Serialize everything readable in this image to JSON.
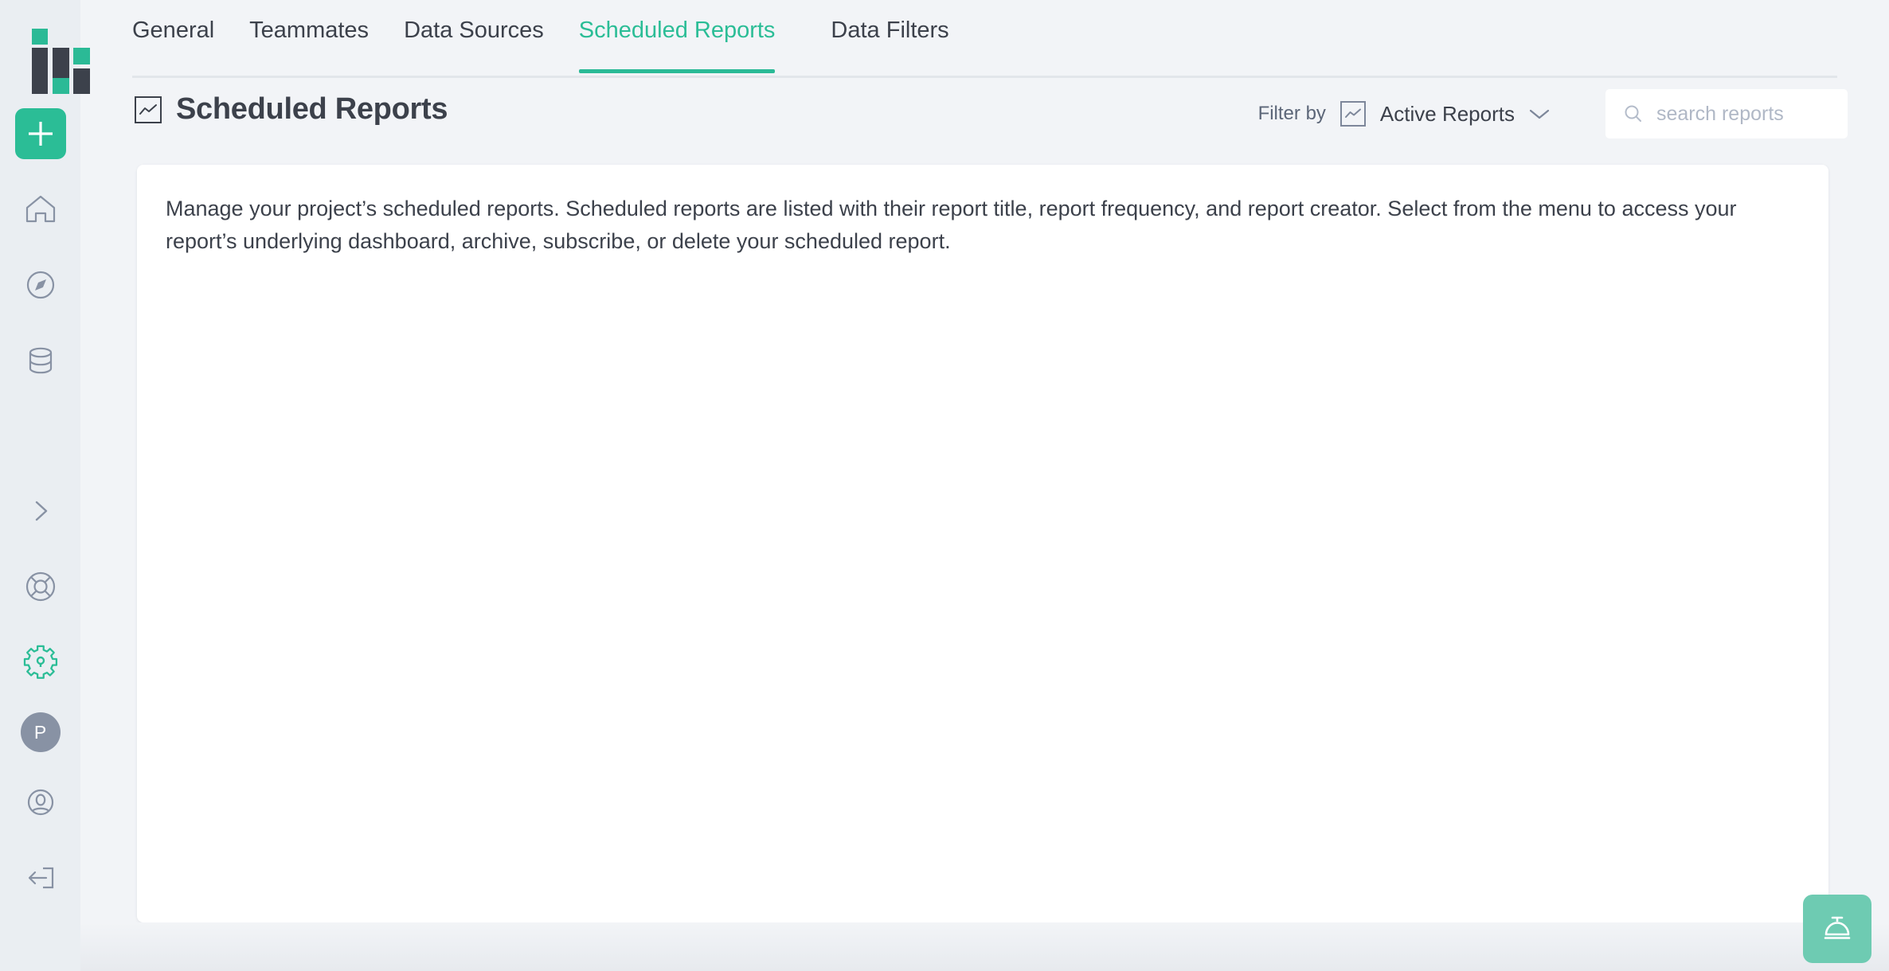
{
  "app": {
    "logo_name": "hive-logo",
    "accent_color": "#2bbd96",
    "dark_color": "#3c414b",
    "muted_color": "#8892a4"
  },
  "sidebar": {
    "add_button_label": "+",
    "items": [
      {
        "name": "home",
        "icon": "home-icon"
      },
      {
        "name": "explore",
        "icon": "compass-icon"
      },
      {
        "name": "data",
        "icon": "database-icon"
      },
      {
        "name": "expand",
        "icon": "chevron-right-icon"
      },
      {
        "name": "support",
        "icon": "lifebuoy-icon"
      },
      {
        "name": "settings",
        "icon": "gear-icon",
        "active": true
      },
      {
        "name": "project",
        "icon": "avatar",
        "label": "P"
      },
      {
        "name": "account",
        "icon": "user-circle-icon"
      },
      {
        "name": "logout",
        "icon": "logout-icon"
      }
    ]
  },
  "tabs": [
    {
      "label": "General",
      "active": false
    },
    {
      "label": "Teammates",
      "active": false
    },
    {
      "label": "Data Sources",
      "active": false
    },
    {
      "label": "Scheduled Reports",
      "active": true
    },
    {
      "label": "Data Filters",
      "active": false
    }
  ],
  "header": {
    "title": "Scheduled Reports",
    "title_icon": "line-chart-icon"
  },
  "filter": {
    "label": "Filter by",
    "icon": "line-chart-icon",
    "value": "Active Reports",
    "chevron": "chevron-down-icon",
    "options": [
      "Active Reports"
    ]
  },
  "search": {
    "icon": "search-icon",
    "placeholder": "search reports",
    "value": ""
  },
  "main": {
    "description": "Manage your project’s scheduled reports. Scheduled reports are listed with their report title, report frequency, and report creator. Select from the menu to access your report’s underlying dashboard, archive, subscribe, or delete your scheduled report."
  },
  "fab": {
    "icon": "service-bell-icon",
    "color": "#6ecbb2"
  }
}
